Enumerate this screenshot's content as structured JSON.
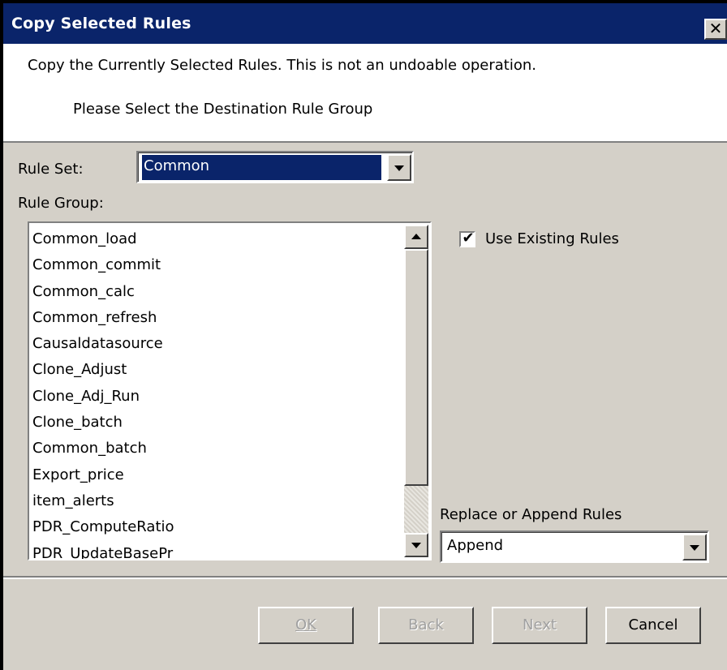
{
  "window": {
    "title": "Copy Selected Rules",
    "close_glyph": "✕"
  },
  "header": {
    "description": "Copy the Currently Selected Rules. This is not an undoable operation.",
    "instruction": "Please Select the Destination Rule Group"
  },
  "rule_set": {
    "label": "Rule Set:",
    "value": "Common"
  },
  "rule_group": {
    "label": "Rule Group:",
    "items": [
      "Common_load",
      "Common_commit",
      "Common_calc",
      "Common_refresh",
      "Causaldatasource",
      "Clone_Adjust",
      "Clone_Adj_Run",
      "Clone_batch",
      "Common_batch",
      "Export_price",
      "item_alerts",
      "PDR_ComputeRatio",
      "PDR_UpdateBasePr"
    ]
  },
  "options": {
    "use_existing_label": "Use Existing Rules",
    "use_existing_checked": true,
    "replace_append_label": "Replace or Append Rules",
    "replace_append_value": "Append"
  },
  "buttons": {
    "ok": "OK",
    "back": "Back",
    "next": "Next",
    "cancel": "Cancel"
  },
  "colors": {
    "titlebar": "#0a246a",
    "dialog_bg": "#d4d0c8",
    "selection": "#0a246a"
  }
}
